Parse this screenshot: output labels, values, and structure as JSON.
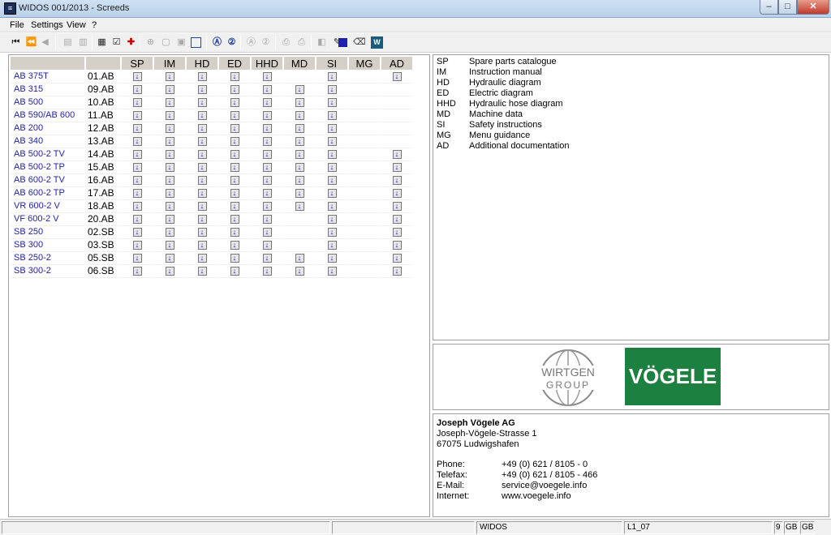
{
  "window": {
    "title": "WIDOS 001/2013 - Screeds",
    "app_icon": "WIDOS"
  },
  "menu": [
    "File",
    "Settings",
    "View",
    "?"
  ],
  "toolbar": {
    "icons": [
      "first-icon",
      "previous-section-icon",
      "previous-icon",
      "copy-icon",
      "paste-icon",
      "print-icon",
      "checklist-icon",
      "add-icon",
      "zoom-icon",
      "page-icon",
      "page-fit-icon",
      "frame-icon",
      "search-a-icon",
      "search-2-icon",
      "search-a-disabled-icon",
      "search-2-disabled-icon",
      "printer-icon",
      "printer-all-icon",
      "stamp-icon",
      "eraser-icon",
      "color-icon",
      "widos-icon"
    ]
  },
  "models": {
    "headers": [
      "",
      "",
      "SP",
      "IM",
      "HD",
      "ED",
      "HHD",
      "MD",
      "SI",
      "MG",
      "AD"
    ],
    "rows": [
      {
        "name": "AB 375T",
        "code": "01.AB",
        "docs": [
          1,
          1,
          1,
          1,
          1,
          0,
          1,
          0,
          1
        ]
      },
      {
        "name": "AB 315",
        "code": "09.AB",
        "docs": [
          1,
          1,
          1,
          1,
          1,
          1,
          1,
          0,
          0
        ]
      },
      {
        "name": "AB 500",
        "code": "10.AB",
        "docs": [
          1,
          1,
          1,
          1,
          1,
          1,
          1,
          0,
          0
        ]
      },
      {
        "name": "AB 590/AB 600",
        "code": "11.AB",
        "docs": [
          1,
          1,
          1,
          1,
          1,
          1,
          1,
          0,
          0
        ]
      },
      {
        "name": "AB 200",
        "code": "12.AB",
        "docs": [
          1,
          1,
          1,
          1,
          1,
          1,
          1,
          0,
          0
        ]
      },
      {
        "name": "AB 340",
        "code": "13.AB",
        "docs": [
          1,
          1,
          1,
          1,
          1,
          1,
          1,
          0,
          0
        ]
      },
      {
        "name": "AB 500-2 TV",
        "code": "14.AB",
        "docs": [
          1,
          1,
          1,
          1,
          1,
          1,
          1,
          0,
          1
        ]
      },
      {
        "name": "AB 500-2 TP",
        "code": "15.AB",
        "docs": [
          1,
          1,
          1,
          1,
          1,
          1,
          1,
          0,
          1
        ]
      },
      {
        "name": "AB 600-2 TV",
        "code": "16.AB",
        "docs": [
          1,
          1,
          1,
          1,
          1,
          1,
          1,
          0,
          1
        ]
      },
      {
        "name": "AB 600-2 TP",
        "code": "17.AB",
        "docs": [
          1,
          1,
          1,
          1,
          1,
          1,
          1,
          0,
          1
        ]
      },
      {
        "name": "VR 600-2 V",
        "code": "18.AB",
        "docs": [
          1,
          1,
          1,
          1,
          1,
          1,
          1,
          0,
          1
        ]
      },
      {
        "name": "VF 600-2 V",
        "code": "20.AB",
        "docs": [
          1,
          1,
          1,
          1,
          1,
          0,
          1,
          0,
          1
        ]
      },
      {
        "name": "SB 250",
        "code": "02.SB",
        "docs": [
          1,
          1,
          1,
          1,
          1,
          0,
          1,
          0,
          1
        ]
      },
      {
        "name": "SB 300",
        "code": "03.SB",
        "docs": [
          1,
          1,
          1,
          1,
          1,
          0,
          1,
          0,
          1
        ]
      },
      {
        "name": "SB 250-2",
        "code": "05.SB",
        "docs": [
          1,
          1,
          1,
          1,
          1,
          1,
          1,
          0,
          1
        ]
      },
      {
        "name": "SB 300-2",
        "code": "06.SB",
        "docs": [
          1,
          1,
          1,
          1,
          1,
          1,
          1,
          0,
          1
        ]
      }
    ]
  },
  "legend": [
    {
      "abbr": "SP",
      "desc": "Spare parts catalogue"
    },
    {
      "abbr": "IM",
      "desc": "Instruction manual"
    },
    {
      "abbr": "HD",
      "desc": "Hydraulic diagram"
    },
    {
      "abbr": "ED",
      "desc": "Electric diagram"
    },
    {
      "abbr": "HHD",
      "desc": "Hydraulic hose diagram"
    },
    {
      "abbr": "MD",
      "desc": "Machine data"
    },
    {
      "abbr": "SI",
      "desc": "Safety instructions"
    },
    {
      "abbr": "MG",
      "desc": "Menu guidance"
    },
    {
      "abbr": "AD",
      "desc": "Additional documentation"
    }
  ],
  "logos": {
    "wirtgen_line1": "WIRTGEN",
    "wirtgen_line2": "GROUP",
    "voegele": "VÖGELE"
  },
  "contact": {
    "company": "Joseph Vögele AG",
    "street": "Joseph-Vögele-Strasse 1",
    "city": "67075 Ludwigshafen",
    "phone_label": "Phone:",
    "phone": "+49 (0) 621 / 8105 - 0",
    "fax_label": "Telefax:",
    "fax": "+49 (0) 621 / 8105 - 466",
    "email_label": "E-Mail:",
    "email": "service@voegele.info",
    "internet_label": "Internet:",
    "internet": "www.voegele.info"
  },
  "status": {
    "app": "WIDOS",
    "code": "L1_07",
    "num": "9",
    "lang1": "GB",
    "lang2": "GB"
  }
}
